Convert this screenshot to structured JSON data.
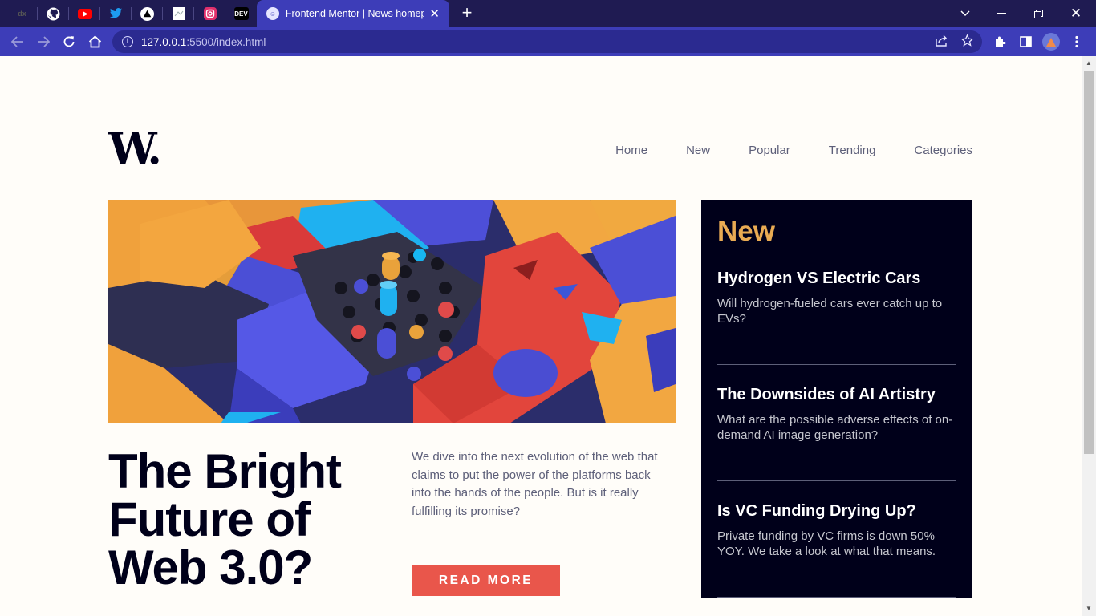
{
  "browser": {
    "pinned_tabs": [
      {
        "icon": "dx-icon",
        "text": "dx",
        "color": "#1f1b52"
      },
      {
        "icon": "github-icon",
        "text": "",
        "color": "#ffffff"
      },
      {
        "icon": "youtube-icon",
        "text": "",
        "color": "#ff0000"
      },
      {
        "icon": "twitter-icon",
        "text": "",
        "color": "#1d9bf0"
      },
      {
        "icon": "vercel-icon",
        "text": "",
        "color": "#000000"
      },
      {
        "icon": "mail-icon",
        "text": "",
        "color": "#ffffff"
      },
      {
        "icon": "instagram-icon",
        "text": "",
        "color": "#e1306c"
      },
      {
        "icon": "dev-icon",
        "text": "DEV",
        "color": "#000000"
      }
    ],
    "active_tab_title": "Frontend Mentor | News homepage",
    "url_host": "127.0.0.1",
    "url_rest": ":5500/index.html"
  },
  "page": {
    "logo": "W.",
    "nav": [
      "Home",
      "New",
      "Popular",
      "Trending",
      "Categories"
    ],
    "headline": "The Bright Future of Web 3.0?",
    "description": "We dive into the next evolution of the web that claims to put the power of the platforms back into the hands of the people. But is it really fulfilling its promise?",
    "cta": "READ MORE",
    "new_section": {
      "title": "New",
      "items": [
        {
          "title": "Hydrogen VS Electric Cars",
          "text": "Will hydrogen-fueled cars ever catch up to EVs?"
        },
        {
          "title": "The Downsides of AI Artistry",
          "text": "What are the possible adverse effects of on-demand AI image generation?"
        },
        {
          "title": "Is VC Funding Drying Up?",
          "text": "Private funding by VC firms is down 50% YOY. We take a look at what that means."
        }
      ]
    }
  },
  "colors": {
    "accent": "#e9564b",
    "highlight": "#e9ab53",
    "dark": "#00001a",
    "muted": "#5d5f79"
  }
}
